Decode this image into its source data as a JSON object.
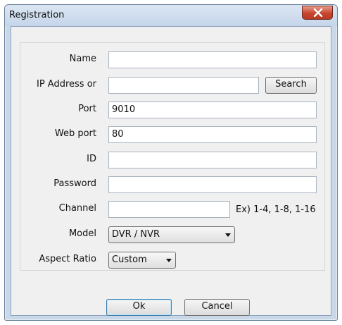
{
  "window": {
    "title": "Registration"
  },
  "form": {
    "name_label": "Name",
    "name_value": "",
    "ip_label": "IP Address or",
    "ip_value": "",
    "search_label": "Search",
    "port_label": "Port",
    "port_value": "9010",
    "webport_label": "Web port",
    "webport_value": "80",
    "id_label": "ID",
    "id_value": "",
    "password_label": "Password",
    "password_value": "",
    "channel_label": "Channel",
    "channel_value": "",
    "channel_hint": "Ex) 1-4, 1-8, 1-16",
    "model_label": "Model",
    "model_value": "DVR / NVR",
    "aspect_label": "Aspect Ratio",
    "aspect_value": "Custom"
  },
  "buttons": {
    "ok_label": "Ok",
    "cancel_label": "Cancel"
  },
  "icons": {
    "close": "close-icon",
    "dropdown": "chevron-down-icon"
  },
  "colors": {
    "close_button": "#c7452f",
    "titlebar": "#c9d8e8"
  }
}
